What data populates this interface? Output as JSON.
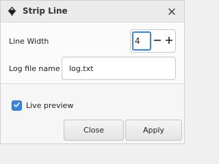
{
  "window": {
    "title": "Strip Line",
    "app_icon": "inkscape-logo-icon",
    "close_icon": "close-icon"
  },
  "form": {
    "line_width_label": "Line Width",
    "line_width_value": "4",
    "decrement_label": "−",
    "increment_label": "+",
    "log_file_label": "Log file name",
    "log_file_value": "log.txt"
  },
  "options": {
    "live_preview_label": "Live preview",
    "live_preview_checked": true
  },
  "buttons": {
    "close_label": "Close",
    "apply_label": "Apply"
  },
  "colors": {
    "accent": "#3584e4"
  }
}
